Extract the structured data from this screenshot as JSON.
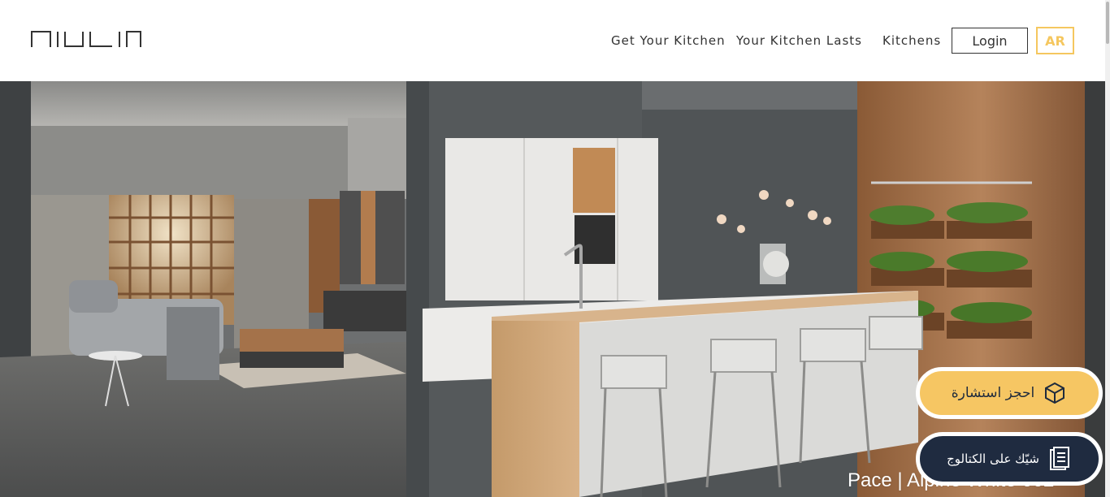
{
  "header": {
    "logo_text": "niuli",
    "nav": [
      {
        "label": "Get Your Kitchen"
      },
      {
        "label": "Your Kitchen Lasts"
      },
      {
        "label": "Kitchens"
      }
    ],
    "login_label": "Login",
    "language_label": "AR"
  },
  "hero": {
    "caption": "Pace | Alpine White 002"
  },
  "floating": {
    "book_consultation": "احجز استشارة",
    "check_catalog": "شيّك على الكتالوج"
  },
  "colors": {
    "accent_yellow": "#f6c663",
    "navy": "#1f2b40"
  },
  "icons": {
    "book": "cube-box-icon",
    "catalog": "catalog-book-icon"
  }
}
